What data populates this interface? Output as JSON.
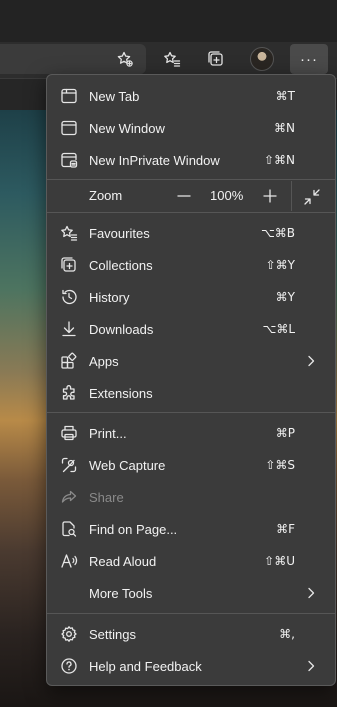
{
  "toolbar": {
    "more_label": "···"
  },
  "menu": {
    "items": [
      {
        "label": "New Tab",
        "shortcut": "⌘T"
      },
      {
        "label": "New Window",
        "shortcut": "⌘N"
      },
      {
        "label": "New InPrivate Window",
        "shortcut": "⇧⌘N"
      },
      {
        "label": "Favourites",
        "shortcut": "⌥⌘B"
      },
      {
        "label": "Collections",
        "shortcut": "⇧⌘Y"
      },
      {
        "label": "History",
        "shortcut": "⌘Y"
      },
      {
        "label": "Downloads",
        "shortcut": "⌥⌘L"
      },
      {
        "label": "Apps",
        "shortcut": ""
      },
      {
        "label": "Extensions",
        "shortcut": ""
      },
      {
        "label": "Print...",
        "shortcut": "⌘P"
      },
      {
        "label": "Web Capture",
        "shortcut": "⇧⌘S"
      },
      {
        "label": "Share",
        "shortcut": ""
      },
      {
        "label": "Find on Page...",
        "shortcut": "⌘F"
      },
      {
        "label": "Read Aloud",
        "shortcut": "⇧⌘U"
      },
      {
        "label": "More Tools",
        "shortcut": ""
      },
      {
        "label": "Settings",
        "shortcut": "⌘,"
      },
      {
        "label": "Help and Feedback",
        "shortcut": ""
      }
    ],
    "zoom": {
      "label": "Zoom",
      "minus": "—",
      "value": "100%",
      "plus": "+"
    }
  }
}
